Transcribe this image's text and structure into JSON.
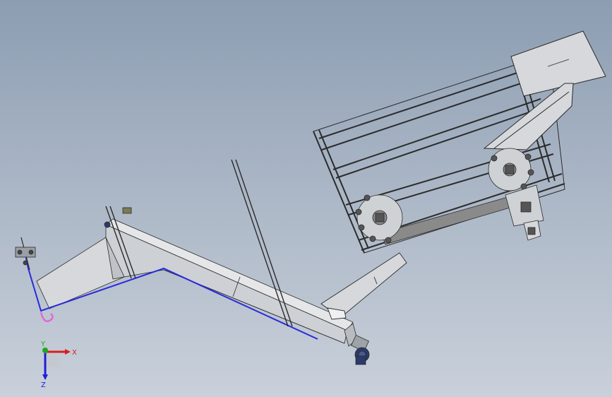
{
  "viewport": {
    "background_top": "#8c9db2",
    "background_bottom": "#c9d0da"
  },
  "model": {
    "steel_color": "#d6d8db",
    "edge_color": "#2b2b2b",
    "channel_color": "#2a2ad8",
    "drain_color": "#e06ad0",
    "motor_color": "#2b3a6b",
    "sprocket_color": "#8a8a8a"
  },
  "triad": {
    "x_label": "X",
    "y_label": "Y",
    "z_label": "Z",
    "x_color": "#d81e1e",
    "y_color": "#1ea81e",
    "z_color": "#1e1ed8"
  }
}
